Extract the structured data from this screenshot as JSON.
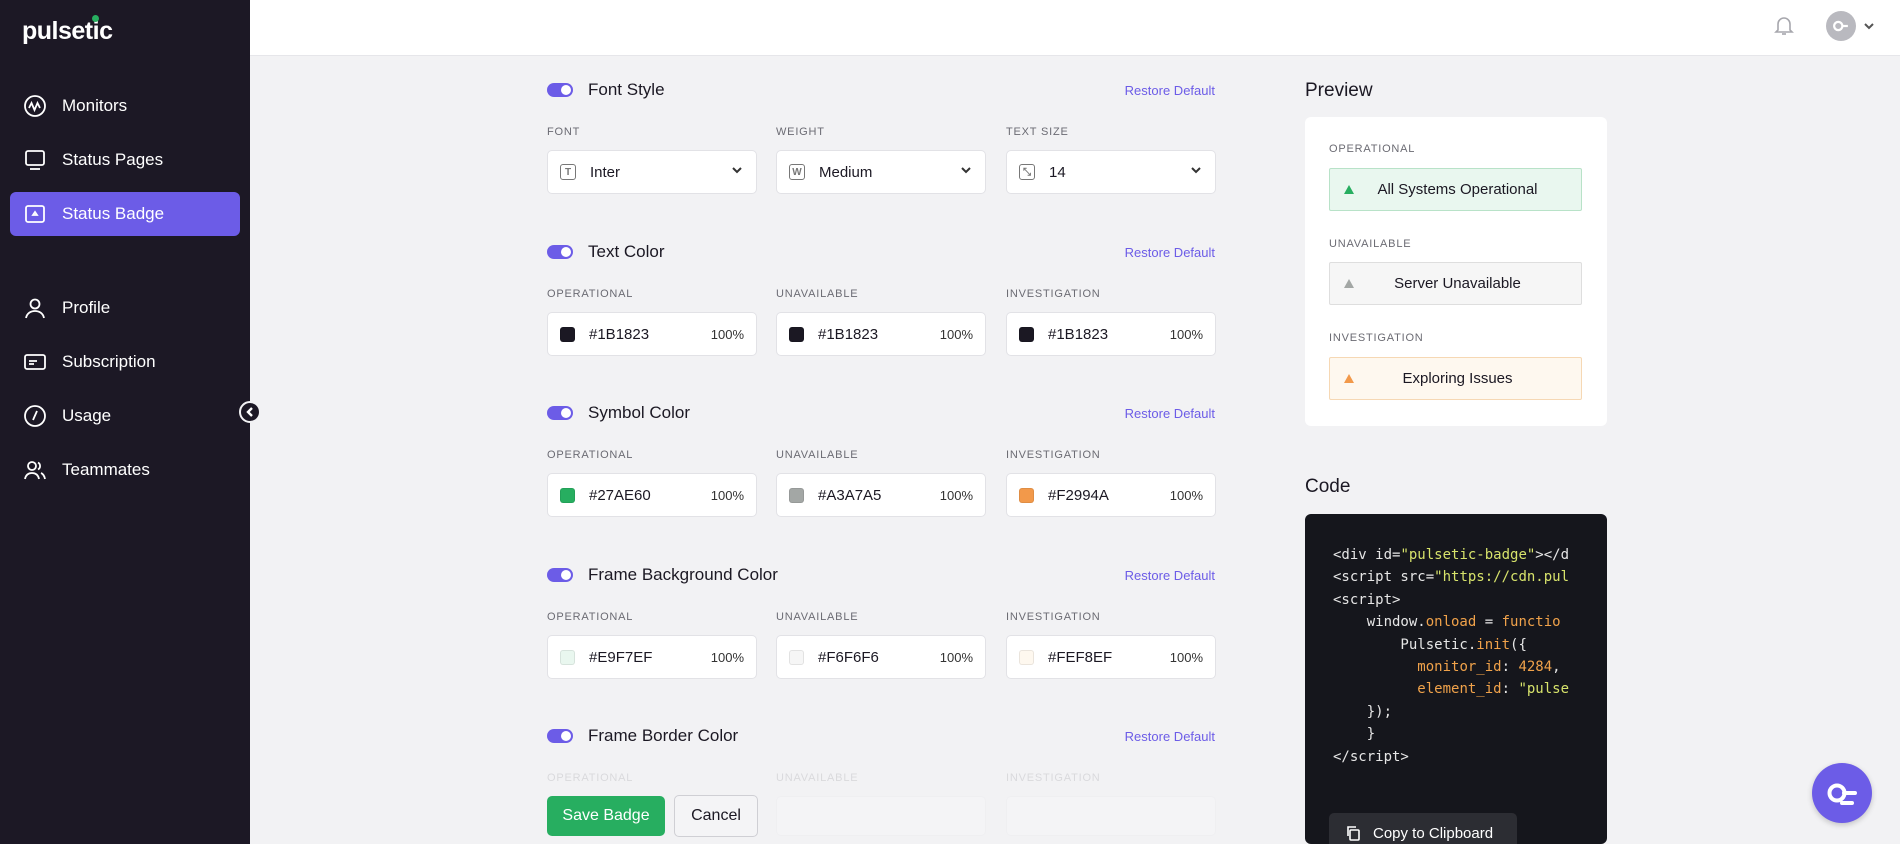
{
  "app": {
    "logo": "pulsetic"
  },
  "sidebar": {
    "items": [
      {
        "label": "Monitors",
        "icon": "monitor-pulse-icon"
      },
      {
        "label": "Status Pages",
        "icon": "screen-icon"
      },
      {
        "label": "Status Badge",
        "icon": "badge-icon",
        "active": true
      },
      {
        "label": "Profile",
        "icon": "person-icon"
      },
      {
        "label": "Subscription",
        "icon": "card-icon"
      },
      {
        "label": "Usage",
        "icon": "gauge-icon"
      },
      {
        "label": "Teammates",
        "icon": "people-icon"
      }
    ]
  },
  "sections": {
    "font_style": {
      "title": "Font Style",
      "restore": "Restore Default",
      "labels": [
        "FONT",
        "WEIGHT",
        "TEXT SIZE"
      ],
      "font": "Inter",
      "weight": "Medium",
      "size": "14"
    },
    "text_color": {
      "title": "Text Color",
      "restore": "Restore Default",
      "fields": [
        {
          "label": "OPERATIONAL",
          "hex": "#1B1823",
          "pct": "100%"
        },
        {
          "label": "UNAVAILABLE",
          "hex": "#1B1823",
          "pct": "100%"
        },
        {
          "label": "INVESTIGATION",
          "hex": "#1B1823",
          "pct": "100%"
        }
      ]
    },
    "symbol_color": {
      "title": "Symbol Color",
      "restore": "Restore Default",
      "fields": [
        {
          "label": "OPERATIONAL",
          "hex": "#27AE60",
          "pct": "100%"
        },
        {
          "label": "UNAVAILABLE",
          "hex": "#A3A7A5",
          "pct": "100%"
        },
        {
          "label": "INVESTIGATION",
          "hex": "#F2994A",
          "pct": "100%"
        }
      ]
    },
    "frame_bg": {
      "title": "Frame Background Color",
      "restore": "Restore Default",
      "fields": [
        {
          "label": "OPERATIONAL",
          "hex": "#E9F7EF",
          "pct": "100%"
        },
        {
          "label": "UNAVAILABLE",
          "hex": "#F6F6F6",
          "pct": "100%"
        },
        {
          "label": "INVESTIGATION",
          "hex": "#FEF8EF",
          "pct": "100%"
        }
      ]
    },
    "frame_border": {
      "title": "Frame Border Color",
      "restore": "Restore Default",
      "labels": [
        "OPERATIONAL",
        "UNAVAILABLE",
        "INVESTIGATION"
      ]
    }
  },
  "actions": {
    "save": "Save Badge",
    "cancel": "Cancel"
  },
  "preview": {
    "title": "Preview",
    "items": [
      {
        "label": "OPERATIONAL",
        "text": "All Systems Operational"
      },
      {
        "label": "UNAVAILABLE",
        "text": "Server Unavailable"
      },
      {
        "label": "INVESTIGATION",
        "text": "Exploring Issues"
      }
    ]
  },
  "code": {
    "title": "Code",
    "copy": "Copy to Clipboard"
  }
}
